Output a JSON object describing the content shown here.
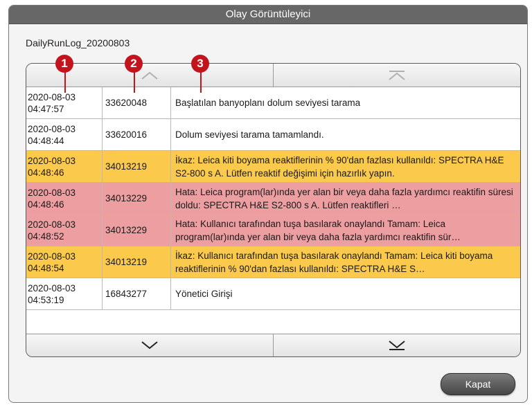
{
  "window": {
    "title": "Olay Görüntüleyici"
  },
  "log": {
    "name": "DailyRunLog_20200803"
  },
  "callouts": [
    "1",
    "2",
    "3"
  ],
  "rows": [
    {
      "date": "2020-08-03",
      "time": "04:47:57",
      "code": "33620048",
      "message": "Başlatılan banyoplanı dolum seviyesi tarama",
      "status": "info"
    },
    {
      "date": "2020-08-03",
      "time": "04:48:44",
      "code": "33620016",
      "message": "Dolum seviyesi tarama tamamlandı.",
      "status": "info"
    },
    {
      "date": "2020-08-03",
      "time": "04:48:46",
      "code": "34013219",
      "message": "İkaz: Leica kiti boyama reaktiflerinin % 90'dan fazlası kullanıldı: SPECTRA H&E S2-800 s A. Lütfen reaktif değişimi için hazırlık yapın.",
      "status": "warning"
    },
    {
      "date": "2020-08-03",
      "time": "04:48:46",
      "code": "34013229",
      "message": "Hata: Leica program(lar)ında yer alan bir veya daha fazla yardımcı reaktifin süresi doldu: SPECTRA H&E S2-800 s A. Lütfen reaktifleri …",
      "status": "error"
    },
    {
      "date": "2020-08-03",
      "time": "04:48:52",
      "code": "34013229",
      "message": "Hata: Kullanıcı tarafından tuşa basılarak onaylandı Tamam: Leica program(lar)ında yer alan bir veya daha fazla yardımcı reaktifin sür…",
      "status": "error"
    },
    {
      "date": "2020-08-03",
      "time": "04:48:54",
      "code": "34013219",
      "message": "İkaz: Kullanıcı tarafından tuşa basılarak onaylandı Tamam: Leica kiti boyama reaktiflerinin % 90'dan fazlası kullanıldı: SPECTRA H&E S…",
      "status": "warning"
    },
    {
      "date": "2020-08-03",
      "time": "04:53:19",
      "code": "16843277",
      "message": "Yönetici Girişi",
      "status": "info"
    }
  ],
  "buttons": {
    "close": "Kapat"
  },
  "icons": {
    "scroll_up": "chevron-up-icon",
    "scroll_top": "scroll-to-top-icon",
    "scroll_down": "chevron-down-icon",
    "scroll_bottom": "scroll-to-bottom-icon"
  },
  "colors": {
    "warning": "#fbc94b",
    "error": "#ec9ea1",
    "callout": "#c3141e",
    "titlebar": "#676767"
  }
}
